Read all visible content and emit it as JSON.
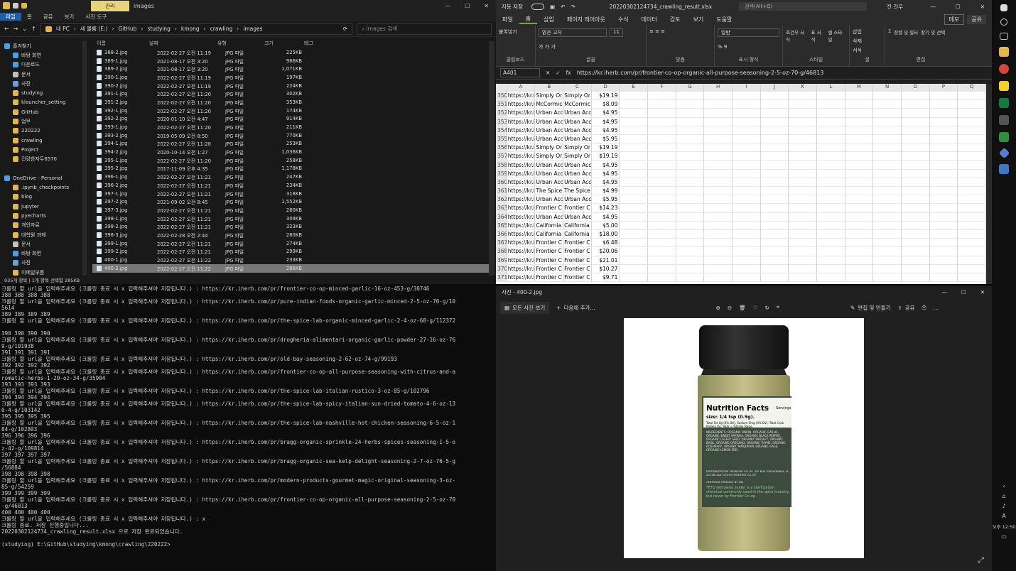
{
  "explorer": {
    "ribbon_tab_manage": "관리",
    "title": "images",
    "tabs": [
      "파일",
      "홈",
      "공유",
      "보기",
      "사진 도구"
    ],
    "breadcrumb": [
      "내 PC",
      "새 볼륨 (E:)",
      "GitHub",
      "studying",
      "kmong",
      "crawling",
      "images"
    ],
    "search_placeholder": "images 검색",
    "nav": [
      {
        "label": "즐겨찾기",
        "color": "#4aa0e8"
      },
      {
        "label": "바탕 화면",
        "color": "#4aa0e8"
      },
      {
        "label": "다운로드",
        "color": "#4aa0e8"
      },
      {
        "label": "문서",
        "color": "#c0c0c0"
      },
      {
        "label": "사진",
        "color": "#6aa0d8"
      },
      {
        "label": "studying",
        "color": "#e2b84c"
      },
      {
        "label": "klauncher_setting",
        "color": "#e2b84c"
      },
      {
        "label": "GitHub",
        "color": "#e2b84c"
      },
      {
        "label": "업무",
        "color": "#e2b84c"
      },
      {
        "label": "220222",
        "color": "#e2b84c"
      },
      {
        "label": "crawling",
        "color": "#e2b84c"
      },
      {
        "label": "Project",
        "color": "#e2b84c"
      },
      {
        "label": "건강한자두6570",
        "color": "#e2b84c"
      },
      {
        "label": "",
        "color": "#191919"
      },
      {
        "label": "OneDrive - Personal",
        "color": "#4aa0e8"
      },
      {
        "label": ".ipynb_checkpoints",
        "color": "#e2b84c"
      },
      {
        "label": "blog",
        "color": "#e2b84c"
      },
      {
        "label": "jupyter",
        "color": "#e2b84c"
      },
      {
        "label": "pyecharts",
        "color": "#e2b84c"
      },
      {
        "label": "개인자료",
        "color": "#e2b84c"
      },
      {
        "label": "대학원 과제",
        "color": "#e2b84c"
      },
      {
        "label": "문서",
        "color": "#c0c0c0"
      },
      {
        "label": "바탕 화면",
        "color": "#4aa0e8"
      },
      {
        "label": "사진",
        "color": "#6aa0d8"
      },
      {
        "label": "이메일부름",
        "color": "#e2b84c"
      }
    ],
    "columns": [
      "이름",
      "날짜",
      "유형",
      "크기",
      "태그"
    ],
    "files": [
      [
        "388-2.jpg",
        "2022-02-27 오전 11:19",
        "JPG 파일",
        "225KB"
      ],
      [
        "389-1.jpg",
        "2021-08-17 오전 3:20",
        "JPG 파일",
        "966KB"
      ],
      [
        "389-2.jpg",
        "2021-08-17 오전 3:20",
        "JPG 파일",
        "1,071KB"
      ],
      [
        "390-1.jpg",
        "2022-02-27 오전 11:19",
        "JPG 파일",
        "197KB"
      ],
      [
        "390-2.jpg",
        "2022-02-27 오전 11:19",
        "JPG 파일",
        "224KB"
      ],
      [
        "391-1.jpg",
        "2022-02-27 오전 11:20",
        "JPG 파일",
        "302KB"
      ],
      [
        "391-2.jpg",
        "2022-02-27 오전 11:20",
        "JPG 파일",
        "353KB"
      ],
      [
        "392-1.jpg",
        "2022-02-27 오전 11:20",
        "JPG 파일",
        "174KB"
      ],
      [
        "392-2.jpg",
        "2020-01-10 오전 4:47",
        "JPG 파일",
        "914KB"
      ],
      [
        "393-1.jpg",
        "2022-02-27 오전 11:20",
        "JPG 파일",
        "211KB"
      ],
      [
        "393-2.jpg",
        "2019-05-09 오전 8:50",
        "JPG 파일",
        "770KB"
      ],
      [
        "394-1.jpg",
        "2022-02-27 오전 11:20",
        "JPG 파일",
        "253KB"
      ],
      [
        "394-2.jpg",
        "2020-10-14 오전 1:27",
        "JPG 파일",
        "1,036KB"
      ],
      [
        "395-1.jpg",
        "2022-02-27 오전 11:20",
        "JPG 파일",
        "258KB"
      ],
      [
        "395-2.jpg",
        "2017-11-09 오후 4:35",
        "JPG 파일",
        "1,178KB"
      ],
      [
        "396-1.jpg",
        "2022-02-27 오전 11:21",
        "JPG 파일",
        "247KB"
      ],
      [
        "396-2.jpg",
        "2022-02-27 오전 11:21",
        "JPG 파일",
        "234KB"
      ],
      [
        "397-1.jpg",
        "2022-02-27 오전 11:21",
        "JPG 파일",
        "318KB"
      ],
      [
        "397-2.jpg",
        "2021-09-02 오전 8:45",
        "JPG 파일",
        "1,552KB"
      ],
      [
        "397-3.jpg",
        "2022-02-27 오전 11:21",
        "JPG 파일",
        "280KB"
      ],
      [
        "398-1.jpg",
        "2022-02-27 오전 11:21",
        "JPG 파일",
        "309KB"
      ],
      [
        "398-2.jpg",
        "2022-02-27 오전 11:21",
        "JPG 파일",
        "323KB"
      ],
      [
        "398-3.jpg",
        "2022-02-28 오전 2:44",
        "JPG 파일",
        "280KB"
      ],
      [
        "399-1.jpg",
        "2022-02-27 오전 11:21",
        "JPG 파일",
        "274KB"
      ],
      [
        "399-2.jpg",
        "2022-02-27 오전 11:21",
        "JPG 파일",
        "299KB"
      ],
      [
        "400-1.jpg",
        "2022-02-27 오전 11:22",
        "JPG 파일",
        "233KB"
      ],
      [
        "400-2.jpg",
        "2022-02-27 오전 11:22",
        "JPG 파일",
        "286KB"
      ]
    ],
    "selected_index": 26,
    "status": "935개 항목  |  1개 항목 선택함 285KB"
  },
  "terminal": {
    "lines": [
      "크롤링 할 url을 입력해주세요 (크롤링 종료 시 x 입력해주셔야 저장됩니다.) : https://kr.iherb.com/pr/frontier-co-op-minced-garlic-16-oz-453-g/30746",
      "388 388 388 388",
      "크롤링 할 url을 입력해주세요 (크롤링 종료 시 x 입력해주셔야 저장됩니다.) : https://kr.iherb.com/pr/pure-indian-foods-organic-garlic-minced-2-5-oz-70-g/10",
      "5614",
      "389 389 389 389",
      "크롤링 할 url을 입력해주세요 (크롤링 종료 시 x 입력해주셔야 저장됩니다.) : https://kr.iherb.com/pr/the-spice-lab-organic-minced-garlic-2-4-oz-68-g/112372",
      "",
      "390 390 390 390",
      "크롤링 할 url을 입력해주세요 (크롤링 종료 시 x 입력해주셔야 저장됩니다.) : https://kr.iherb.com/pr/drogheria-alimentari-organic-garlic-powder-27-16-oz-76",
      "9-g/101938",
      "391 391 391 391",
      "크롤링 할 url을 입력해주세요 (크롤링 종료 시 x 입력해주셔야 저장됩니다.) : https://kr.iherb.com/pr/old-bay-seasoning-2-62-oz-74-g/99193",
      "392 392 392 392",
      "크롤링 할 url을 입력해주세요 (크롤링 종료 시 x 입력해주셔야 저장됩니다.) : https://kr.iherb.com/pr/frontier-co-op-all-purpose-seasoning-with-citrus-and-a",
      "romatic-herbs-1-20-oz-34-g/35904",
      "393 393 393 393",
      "크롤링 할 url을 입력해주세요 (크롤링 종료 시 x 입력해주셔야 저장됩니다.) : https://kr.iherb.com/pr/the-spice-lab-italian-rustico-3-oz-85-g/102796",
      "394 394 394 394",
      "크롤링 할 url을 입력해주세요 (크롤링 종료 시 x 입력해주셔야 저장됩니다.) : https://kr.iherb.com/pr/the-spice-lab-spicy-italian-sun-dried-tomato-4-6-oz-13",
      "0-4-g/103142",
      "395 395 395 395",
      "크롤링 할 url을 입력해주세요 (크롤링 종료 시 x 입력해주셔야 저장됩니다.) : https://kr.iherb.com/pr/the-spice-lab-nashville-hot-chicken-seasoning-6-5-oz-1",
      "84-g/102803",
      "396 396 396 396",
      "크롤링 할 url을 입력해주세요 (크롤링 종료 시 x 입력해주셔야 저장됩니다.) : https://kr.iherb.com/pr/bragg-organic-sprinkle-24-herbs-spices-seasoning-1-5-o",
      "z-42-g/109814",
      "397 397 397 397",
      "크롤링 할 url을 입력해주세요 (크롤링 종료 시 x 입력해주셔야 저장됩니다.) : https://kr.iherb.com/pr/bragg-organic-sea-kelp-delight-seasoning-2-7-oz-76-5-g",
      "/56884",
      "398 398 398 398",
      "크롤링 할 url을 입력해주세요 (크롤링 종료 시 x 입력해주셔야 저장됩니다.) : https://kr.iherb.com/pr/modern-products-gourmet-magic-original-seasoning-3-oz-",
      "85-g/54259",
      "399 399 399 399",
      "크롤링 할 url을 입력해주세요 (크롤링 종료 시 x 입력해주셔야 저장됩니다.) : https://kr.iherb.com/pr/frontier-co-op-organic-all-purpose-seasoning-2-5-oz-70",
      "-g/46813",
      "400 400 400 400",
      "크롤링 할 url을 입력해주세요 (크롤링 종료 시 x 입력해주셔야 저장됩니다.) : x",
      "크롤링 종료. 저장 진행중입니다...",
      "20220302124734_crawling_result.xlsx 으로 저장 완료되었습니다.",
      "",
      "(studying) E:\\GitHub\\studying\\kmong\\crawling\\220222>"
    ]
  },
  "excel": {
    "autosave": "자동 저장",
    "filename": "20220302124734_crawling_result.xlsx",
    "search_placeholder": "검색(Alt+Q)",
    "user": "전 건우",
    "tabs": [
      "파일",
      "홈",
      "삽입",
      "페이지 레이아웃",
      "수식",
      "데이터",
      "검토",
      "보기",
      "도움말"
    ],
    "memo_btn": "메모",
    "share_btn": "공유",
    "groups": [
      {
        "label": "클립보드",
        "items": [
          "붙여넣기"
        ]
      },
      {
        "label": "글꼴",
        "items": [
          "맑은 고딕",
          "11",
          "가 가 가"
        ]
      },
      {
        "label": "맞춤",
        "items": [
          "≡ ≡ ≡"
        ]
      },
      {
        "label": "표시 형식",
        "items": [
          "일반",
          "% 9"
        ]
      },
      {
        "label": "스타일",
        "items": [
          "조건부 서식",
          "표 서식",
          "셀 스타일"
        ]
      },
      {
        "label": "셀",
        "items": [
          "삽입",
          "삭제",
          "서식"
        ]
      },
      {
        "label": "편집",
        "items": [
          "Σ",
          "정렬 및 필터",
          "찾기 및 선택"
        ]
      }
    ],
    "namebox": "A401",
    "formula": "https://kr.iherb.com/pr/frontier-co-op-organic-all-purpose-seasoning-2-5-oz-70-g/46813",
    "columns": [
      "A",
      "B",
      "C",
      "D",
      "E",
      "F",
      "G",
      "H",
      "I",
      "J",
      "K",
      "L",
      "M",
      "N",
      "O",
      "P",
      "Q"
    ],
    "rows": [
      [
        "350",
        "https://kr.i",
        "Simply Or",
        "Simply Or",
        "$19.19"
      ],
      [
        "351",
        "https://kr.i",
        "McCormic",
        "McCormic",
        "$8.09"
      ],
      [
        "352",
        "https://kr.i",
        "Urban Acc",
        "Urban Acc",
        "$4.95"
      ],
      [
        "353",
        "https://kr.i",
        "Urban Acc",
        "Urban Acc",
        "$4.95"
      ],
      [
        "354",
        "https://kr.i",
        "Urban Acc",
        "Urban Acc",
        "$4.95"
      ],
      [
        "355",
        "https://kr.i",
        "Urban Acc",
        "Urban Acc",
        "$5.95"
      ],
      [
        "356",
        "https://kr.i",
        "Simply Or",
        "Simply Or",
        "$19.19"
      ],
      [
        "357",
        "https://kr.i",
        "Simply Or",
        "Simply Or",
        "$19.19"
      ],
      [
        "358",
        "https://kr.i",
        "Urban Acc",
        "Urban Acc",
        "$4.95"
      ],
      [
        "359",
        "https://kr.i",
        "Urban Acc",
        "Urban Acc",
        "$4.95"
      ],
      [
        "360",
        "https://kr.i",
        "Urban Acc",
        "Urban Acc",
        "$4.95"
      ],
      [
        "361",
        "https://kr.i",
        "The Spice",
        "The Spice",
        "$4.99"
      ],
      [
        "362",
        "https://kr.i",
        "Urban Acc",
        "Urban Acc",
        "$5.95"
      ],
      [
        "363",
        "https://kr.i",
        "Frontier C",
        "Frontier C",
        "$14.23"
      ],
      [
        "364",
        "https://kr.i",
        "Urban Acc",
        "Urban Acc",
        "$4.95"
      ],
      [
        "365",
        "https://kr.i",
        "California",
        "California",
        "$5.00"
      ],
      [
        "366",
        "https://kr.i",
        "California",
        "California",
        "$18.00"
      ],
      [
        "367",
        "https://kr.i",
        "Frontier C",
        "Frontier C",
        "$6.48"
      ],
      [
        "368",
        "https://kr.i",
        "Frontier C",
        "Frontier C",
        "$20.06"
      ],
      [
        "369",
        "https://kr.i",
        "Frontier C",
        "Frontier C",
        "$21.01"
      ],
      [
        "370",
        "https://kr.i",
        "Frontier C",
        "Frontier C",
        "$10.27"
      ],
      [
        "371",
        "https://kr.i",
        "Frontier C",
        "Frontier C",
        "$9.71"
      ]
    ]
  },
  "photos": {
    "title": "사진 - 400-2.jpg",
    "all_photos": "모든 사진 보기",
    "add_to": "다음에 추가...",
    "edit": "편집 및 만들기",
    "share": "공유",
    "label": {
      "heading": "Nutrition Facts",
      "serving": "Servings: about",
      "size": "size: 1/4 tsp (0.9g).",
      "fat": "Total Fat 0g (0% DV), Sodium 0mg (0% DV), Total Carb",
      "protein": "Protein 0g. %DV = %Daily Value",
      "ingredients": "INGREDIENTS: ORGANIC ONION, ORGANIC GARLIC, ORGANIC SWEET PAPRIKA, ORGANIC BLACK PEPPER, ORGANIC CELERY SEED, ORGANIC PARSLEY, ORGANIC BASIL, ORGANIC OREGANO, ORGANIC THYME, ORGANIC ROSEMARY, ORGANIC MARJORAM, ORGANIC SAGE, ORGANIC LEMON PEEL",
      "distributor": "DISTRIBUTED BY FRONTIER CO-OP · PO BOX 299 NORWAY, IA 52318 USA ©2019 FRONTIER CO-OP",
      "certified": "CERTIFIED ORGANIC BY QAI",
      "note": "*ETO (ethylene oxide) is a sterilization chemical commonly used in the spice industry, but never by Frontier Co-op."
    }
  },
  "taskbar": {
    "time": "오후 12:50"
  },
  "colors": {
    "accent_excel": "#107c41",
    "selection": "#777777"
  }
}
